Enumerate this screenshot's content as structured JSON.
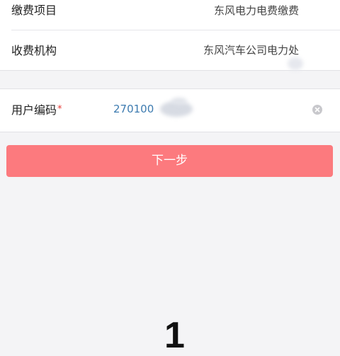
{
  "form": {
    "payment_item": {
      "label": "缴费项目",
      "value": "东风电力电费缴费"
    },
    "billing_org": {
      "label": "收费机构",
      "value": "东风汽车公司电力处"
    },
    "user_code": {
      "label": "用户编码",
      "required_mark": "*",
      "value": "270100",
      "clear_icon": "clear-circle-icon"
    }
  },
  "actions": {
    "next_label": "下一步"
  },
  "overlay": {
    "bottom_glyph": "1"
  },
  "colors": {
    "background": "#f4f4f6",
    "card": "#ffffff",
    "primary_button": "#fc7a7e",
    "input_text": "#3d7bb0",
    "required": "#e53935"
  }
}
